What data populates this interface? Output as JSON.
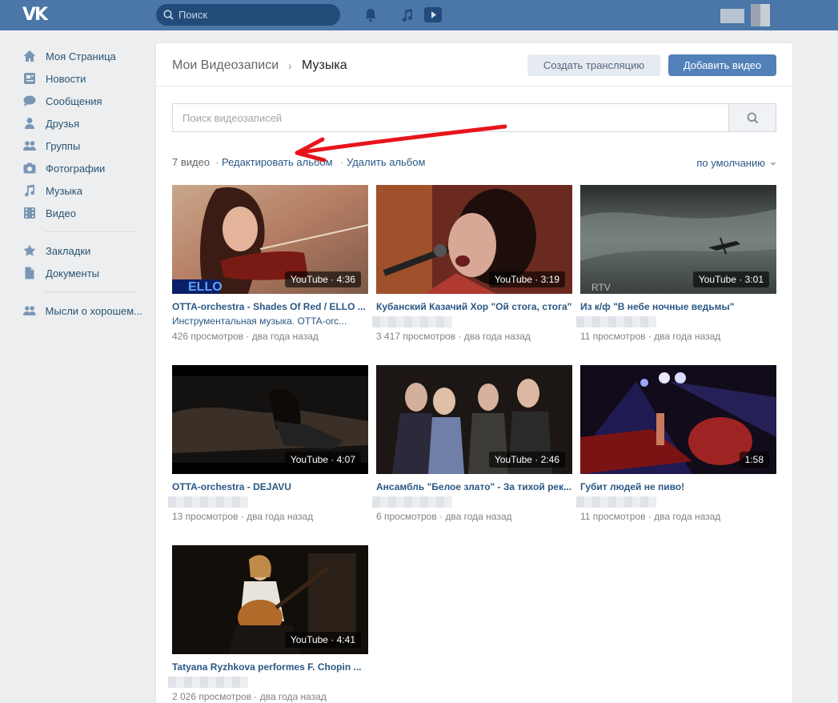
{
  "topbar": {
    "logo_text": "VK",
    "search_placeholder": "Поиск",
    "icons": [
      "bell-icon",
      "music-note-icon",
      "play-video-icon"
    ]
  },
  "sidebar": {
    "items": [
      {
        "label": "Моя Страница",
        "icon": "home-icon"
      },
      {
        "label": "Новости",
        "icon": "news-icon"
      },
      {
        "label": "Сообщения",
        "icon": "messages-icon"
      },
      {
        "label": "Друзья",
        "icon": "friends-icon"
      },
      {
        "label": "Группы",
        "icon": "groups-icon"
      },
      {
        "label": "Фотографии",
        "icon": "camera-icon"
      },
      {
        "label": "Музыка",
        "icon": "music-icon"
      },
      {
        "label": "Видео",
        "icon": "video-icon"
      }
    ],
    "items2": [
      {
        "label": "Закладки",
        "icon": "star-icon"
      },
      {
        "label": "Документы",
        "icon": "document-icon"
      }
    ],
    "items3": [
      {
        "label": "Мысли о хорошем...",
        "icon": "community-icon"
      }
    ]
  },
  "header": {
    "breadcrumb_root": "Мои Видеозаписи",
    "breadcrumb_sep": "›",
    "breadcrumb_current": "Музыка",
    "live_button": "Создать трансляцию",
    "add_button": "Добавить видео"
  },
  "search": {
    "placeholder": "Поиск видеозаписей"
  },
  "album": {
    "count": "7 видео",
    "dot": "·",
    "edit": "Редактировать альбом",
    "delete": "Удалить альбом",
    "sort": "по умолчанию"
  },
  "videos": [
    {
      "title": "OTTA-orchestra - Shades Of Red / ELLO ...",
      "subtitle": "Инструментальная музыка. OTTA-orc...",
      "stats": "426 просмотров · два года назад",
      "duration": "YouTube · 4:36"
    },
    {
      "title": "Кубанский Казачий Хор \"Ой стога, стога\"",
      "subtitle": "",
      "stats": "3 417 просмотров · два года назад",
      "duration": "YouTube · 3:19"
    },
    {
      "title": "Из к/ф \"В небе ночные ведьмы\"",
      "subtitle": "",
      "stats": "11 просмотров · два года назад",
      "duration": "YouTube · 3:01"
    },
    {
      "title": "OTTA-orchestra - DEJAVU",
      "subtitle": "",
      "stats": "13 просмотров · два года назад",
      "duration": "YouTube · 4:07"
    },
    {
      "title": "Ансамбль \"Белое злато\" - За тихой рек...",
      "subtitle": "",
      "stats": "6 просмотров · два года назад",
      "duration": "YouTube · 2:46"
    },
    {
      "title": "Губит людей не пиво!",
      "subtitle": "",
      "stats": "11 просмотров · два года назад",
      "duration": "1:58"
    },
    {
      "title": "Tatyana Ryzhkova performes F. Chopin ...",
      "subtitle": "",
      "stats": "2 026 просмотров · два года назад",
      "duration": "YouTube · 4:41"
    }
  ],
  "colors": {
    "brand": "#4a76a8",
    "link": "#2a5885",
    "accent_button": "#5181b8",
    "arrow": "#e8141b"
  }
}
